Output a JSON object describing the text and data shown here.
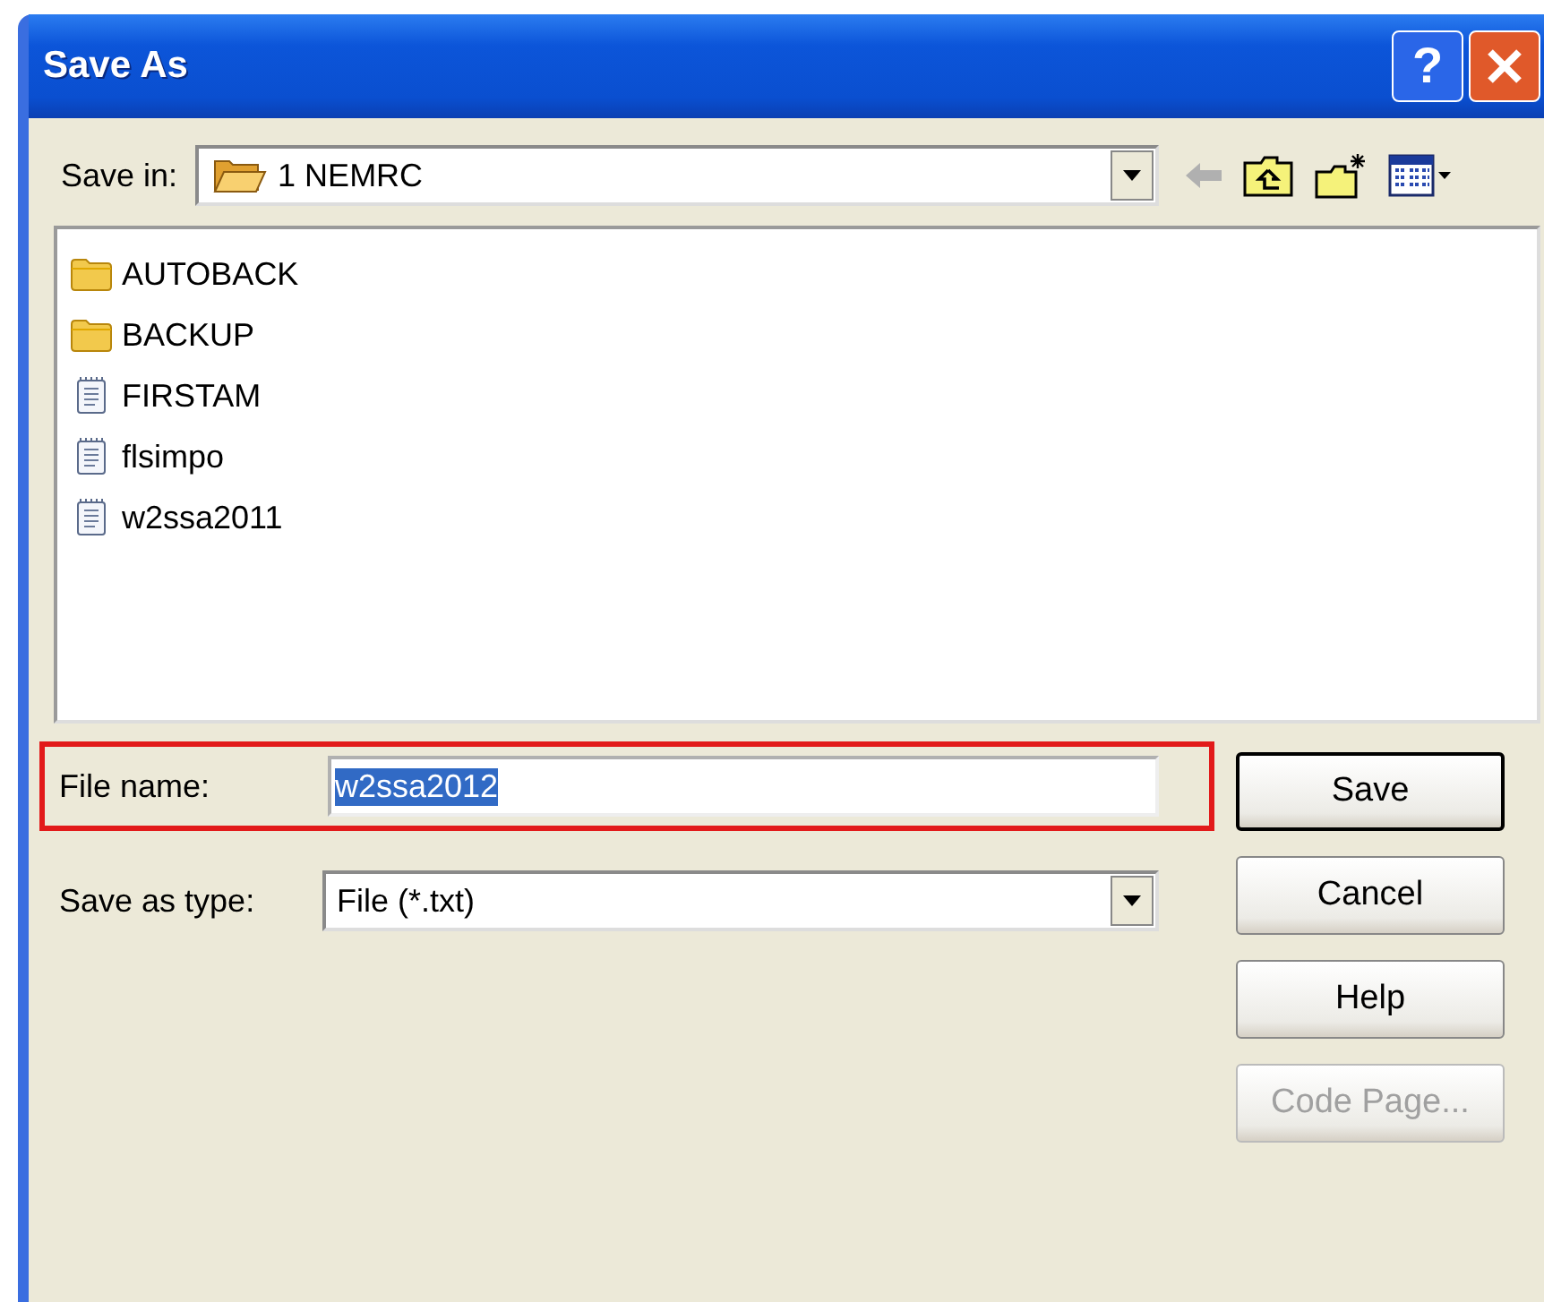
{
  "window": {
    "title": "Save As"
  },
  "title_buttons": [
    {
      "kind": "help",
      "label": "?"
    },
    {
      "kind": "close"
    }
  ],
  "save_in": {
    "label": "Save in:",
    "value": "1 NEMRC"
  },
  "files": [
    {
      "name": "AUTOBACK",
      "kind": "folder"
    },
    {
      "name": "BACKUP",
      "kind": "folder"
    },
    {
      "name": "FIRSTAM",
      "kind": "text"
    },
    {
      "name": "flsimpo",
      "kind": "text"
    },
    {
      "name": "w2ssa2011",
      "kind": "text"
    }
  ],
  "file_name": {
    "label": "File name:",
    "value": "w2ssa2012",
    "highlighted": true
  },
  "save_as_type": {
    "label": "Save as type:",
    "value": "File (*.txt)"
  },
  "buttons": [
    {
      "label": "Save",
      "default": true,
      "disabled": false
    },
    {
      "label": "Cancel",
      "default": false,
      "disabled": false
    },
    {
      "label": "Help",
      "default": false,
      "disabled": false
    },
    {
      "label": "Code Page...",
      "default": false,
      "disabled": true
    }
  ]
}
